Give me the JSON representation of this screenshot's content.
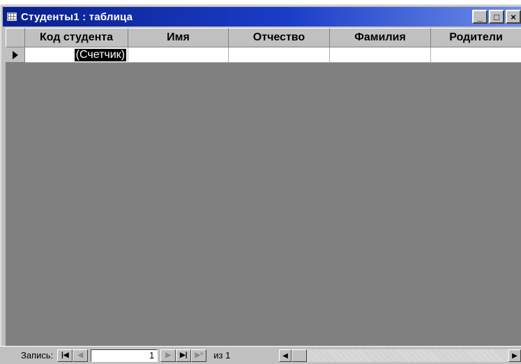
{
  "window": {
    "title": "Студенты1 : таблица",
    "buttons": {
      "minimize": "_",
      "maximize": "□",
      "close": "×"
    }
  },
  "table": {
    "columns": [
      "Код студента",
      "Имя",
      "Отчество",
      "Фамилия",
      "Родители"
    ],
    "new_row": {
      "selector_icon": "current-row-arrow-icon",
      "counter_value": "(Счетчик)",
      "values": [
        "",
        "",
        "",
        ""
      ]
    }
  },
  "status": {
    "record_label": "Запись:",
    "current_record": "1",
    "of_label": "из 1",
    "nav": {
      "first": "|◀",
      "prev": "◀",
      "next": "▶",
      "last": "▶|",
      "new": "▶*"
    }
  },
  "colors": {
    "titlebar": "#0a1f8c",
    "grid_background": "#808080",
    "chrome": "#c0c0c0"
  }
}
